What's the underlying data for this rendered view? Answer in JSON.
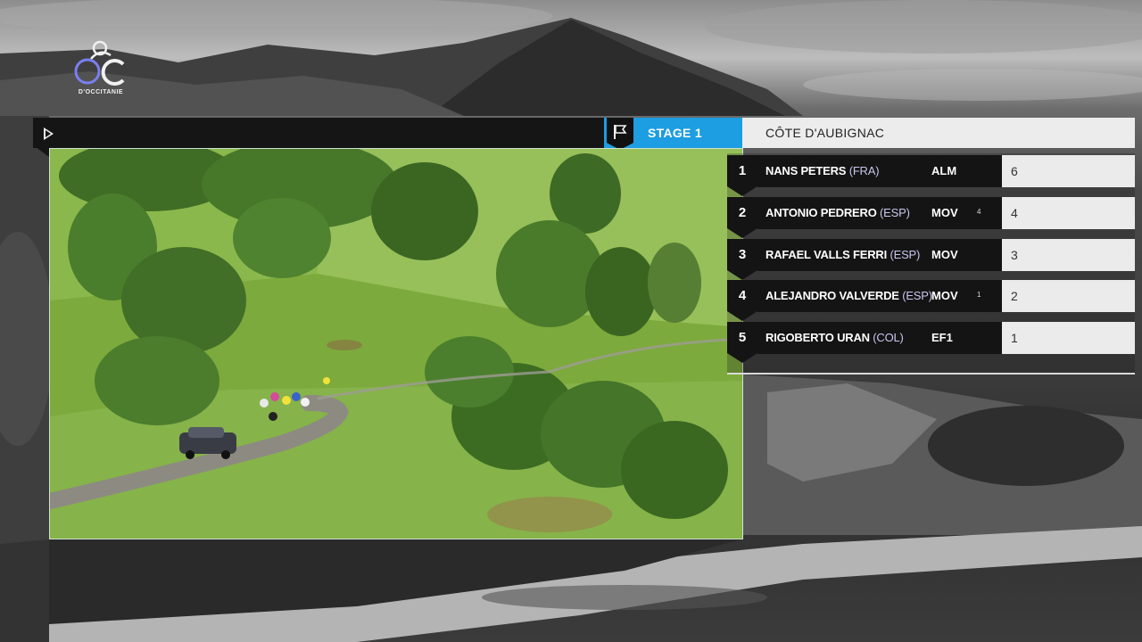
{
  "broadcast": {
    "logo": {
      "text": "OC",
      "subtext": "D'OCCITANIE"
    },
    "stage_label": "STAGE 1",
    "climb_name": "CÔTE D'AUBIGNAC"
  },
  "icons": {
    "play": "play-icon",
    "flag": "flag-icon"
  },
  "colors": {
    "stage_accent": "#1d9de2",
    "panel_dark": "#141414",
    "panel_light": "#ebebeb"
  },
  "standings": [
    {
      "rank": "1",
      "name": "NANS PETERS",
      "nat": "(FRA)",
      "team": "ALM",
      "move": "",
      "points": "6"
    },
    {
      "rank": "2",
      "name": "ANTONIO PEDRERO",
      "nat": "(ESP)",
      "team": "MOV",
      "move": "4",
      "points": "4"
    },
    {
      "rank": "3",
      "name": "RAFAEL VALLS FERRI",
      "nat": "(ESP)",
      "team": "MOV",
      "move": "",
      "points": "3"
    },
    {
      "rank": "4",
      "name": "ALEJANDRO VALVERDE",
      "nat": "(ESP)",
      "team": "MOV",
      "move": "1",
      "points": "2"
    },
    {
      "rank": "5",
      "name": "RIGOBERTO URAN",
      "nat": "(COL)",
      "team": "EF1",
      "move": "",
      "points": "1"
    }
  ]
}
